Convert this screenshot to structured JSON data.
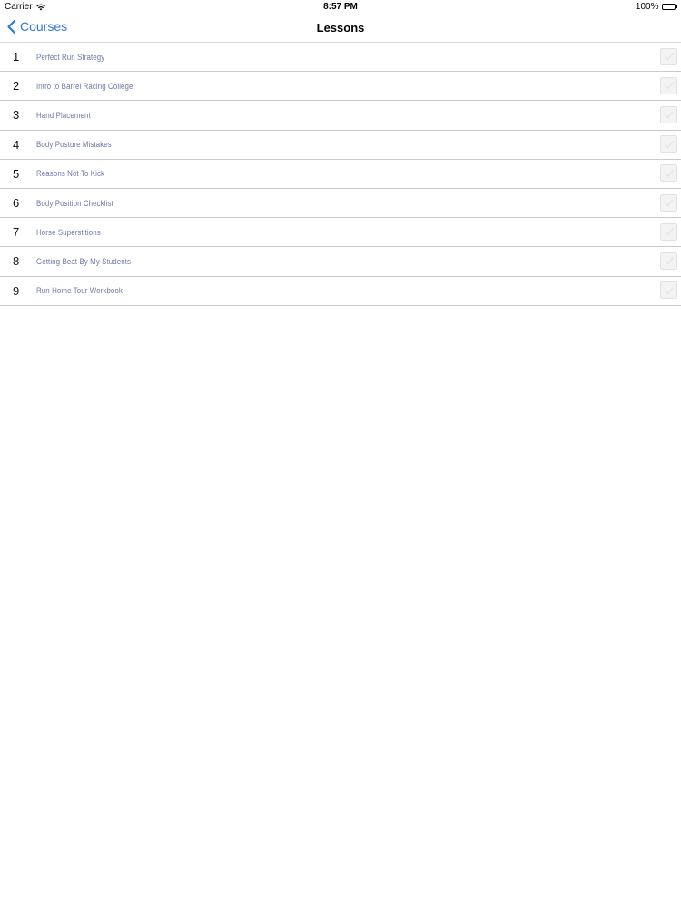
{
  "status_bar": {
    "carrier": "Carrier",
    "time": "8:57 PM",
    "battery_text": "100%",
    "wifi_icon": "wifi-icon",
    "battery_icon": "battery-icon"
  },
  "nav": {
    "back_label": "Courses",
    "back_icon": "chevron-left-icon",
    "title": "Lessons",
    "accent_color": "#2f78d6"
  },
  "lessons": [
    {
      "number": "1",
      "title": "Perfect Run Strategy",
      "completed": false
    },
    {
      "number": "2",
      "title": "Intro to Barrel Racing College",
      "completed": false
    },
    {
      "number": "3",
      "title": "Hand Placement",
      "completed": false
    },
    {
      "number": "4",
      "title": "Body Posture Mistakes",
      "completed": false
    },
    {
      "number": "5",
      "title": "Reasons Not To Kick",
      "completed": false
    },
    {
      "number": "6",
      "title": "Body Position Checklist",
      "completed": false
    },
    {
      "number": "7",
      "title": "Horse Superstitions",
      "completed": false
    },
    {
      "number": "8",
      "title": "Getting Beat By My Students",
      "completed": false
    },
    {
      "number": "9",
      "title": "Run Home Tour Workbook",
      "completed": false
    }
  ],
  "colors": {
    "lesson_title": "#6e78a6",
    "separator": "#c9c9ce",
    "check_box": "#f3f3f4"
  }
}
